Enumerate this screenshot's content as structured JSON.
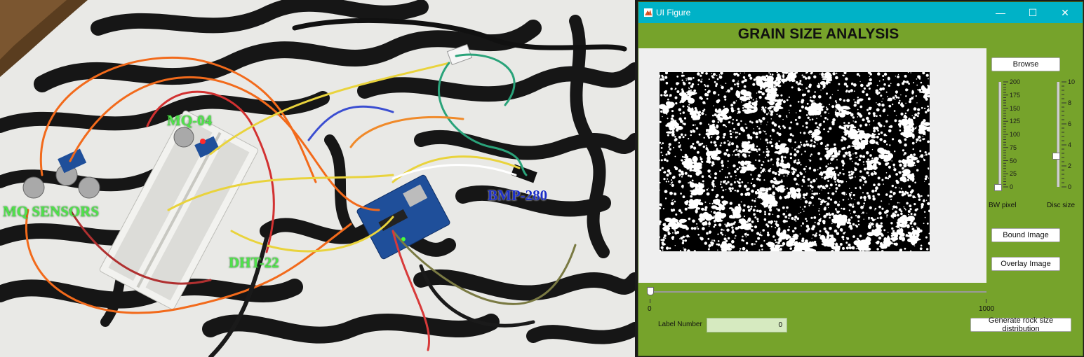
{
  "photo": {
    "labels": {
      "mq04": "MQ-04",
      "mq_sensors": "MQ SENSORS",
      "bmp280": "BMP-280",
      "dht22": "DHT-22"
    }
  },
  "window": {
    "title": "UI Figure",
    "controls": {
      "minimize": "—",
      "maximize": "☐",
      "close": "✕"
    },
    "heading": "GRAIN SIZE ANALYSIS",
    "buttons": {
      "browse": "Browse",
      "bound_image": "Bound Image",
      "overlay_image": "Overlay Image",
      "generate": "Generate rock size distribution"
    },
    "bw_slider": {
      "caption": "BW pixel",
      "ticks": [
        "200",
        "175",
        "150",
        "125",
        "100",
        "75",
        "50",
        "25",
        "0"
      ],
      "min": 0,
      "max": 200,
      "value": 0
    },
    "disc_slider": {
      "caption": "Disc size",
      "ticks": [
        "10",
        "8",
        "6",
        "4",
        "2",
        "0"
      ],
      "min": 0,
      "max": 10,
      "value": 3
    },
    "label_slider": {
      "min_label": "0",
      "max_label": "1000",
      "min": 0,
      "max": 1000,
      "value": 0
    },
    "label_number": {
      "caption": "Label Number",
      "value": "0"
    }
  },
  "colors": {
    "window_bg": "#76a32b",
    "titlebar": "#00b2c7",
    "panel": "#efefef",
    "field": "#d6eac0",
    "photo_label_green": "#4fe34a",
    "photo_label_blue": "#1d2fc8"
  },
  "icons": {
    "app": "matlab-figure-icon"
  }
}
